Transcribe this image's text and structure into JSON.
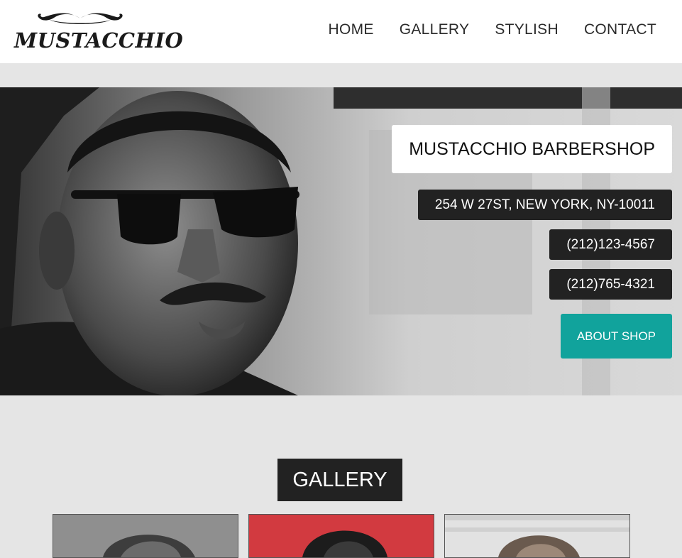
{
  "brand": {
    "logo_text": "MUSTACCHIO"
  },
  "nav": {
    "home": "HOME",
    "gallery": "GALLERY",
    "stylish": "STYLISH",
    "contact": "CONTACT"
  },
  "hero": {
    "title": "MUSTACCHIO BARBERSHOP",
    "address": "254 W 27ST, NEW YORK, NY-10011",
    "phone_1": "(212)123-4567",
    "phone_2": "(212)765-4321",
    "about_button": "ABOUT SHOP"
  },
  "gallery": {
    "heading": "GALLERY"
  },
  "colors": {
    "accent": "#11a39c",
    "dark": "#222222",
    "background": "#e5e5e5"
  }
}
